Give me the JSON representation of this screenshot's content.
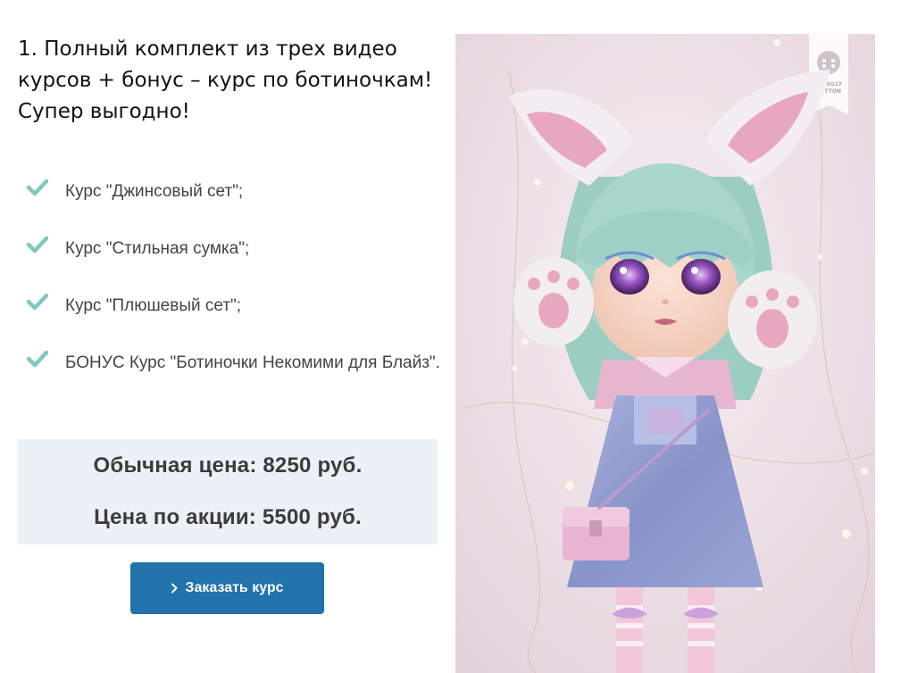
{
  "offer": {
    "heading": "1. Полный комплект из трех видео курсов + бонус – курс по ботиночкам! Супер выгодно!"
  },
  "features": [
    {
      "icon": "check-icon",
      "label": "Курс \"Джинсовый сет\";"
    },
    {
      "icon": "check-icon",
      "label": "Курс \"Стильная сумка\";"
    },
    {
      "icon": "check-icon",
      "label": "Курс \"Плюшевый сет\";"
    },
    {
      "icon": "check-icon",
      "label": "БОНУС Курс \"Ботиночки Некомими для Блайз\"."
    }
  ],
  "pricing": {
    "regular_price": "Обычная цена: 8250 руб.",
    "sale_price": "Цена по акции: 5500 руб."
  },
  "cta": {
    "label": "Заказать курс",
    "icon": "chevron-right-icon"
  },
  "photo": {
    "watermark_text": "MY SILLY BUTTON"
  },
  "colors": {
    "check": "#7ec8c0",
    "price_box_bg": "#ebf1f6",
    "button": "#2272ac",
    "photo_bg": "#eddde4"
  }
}
